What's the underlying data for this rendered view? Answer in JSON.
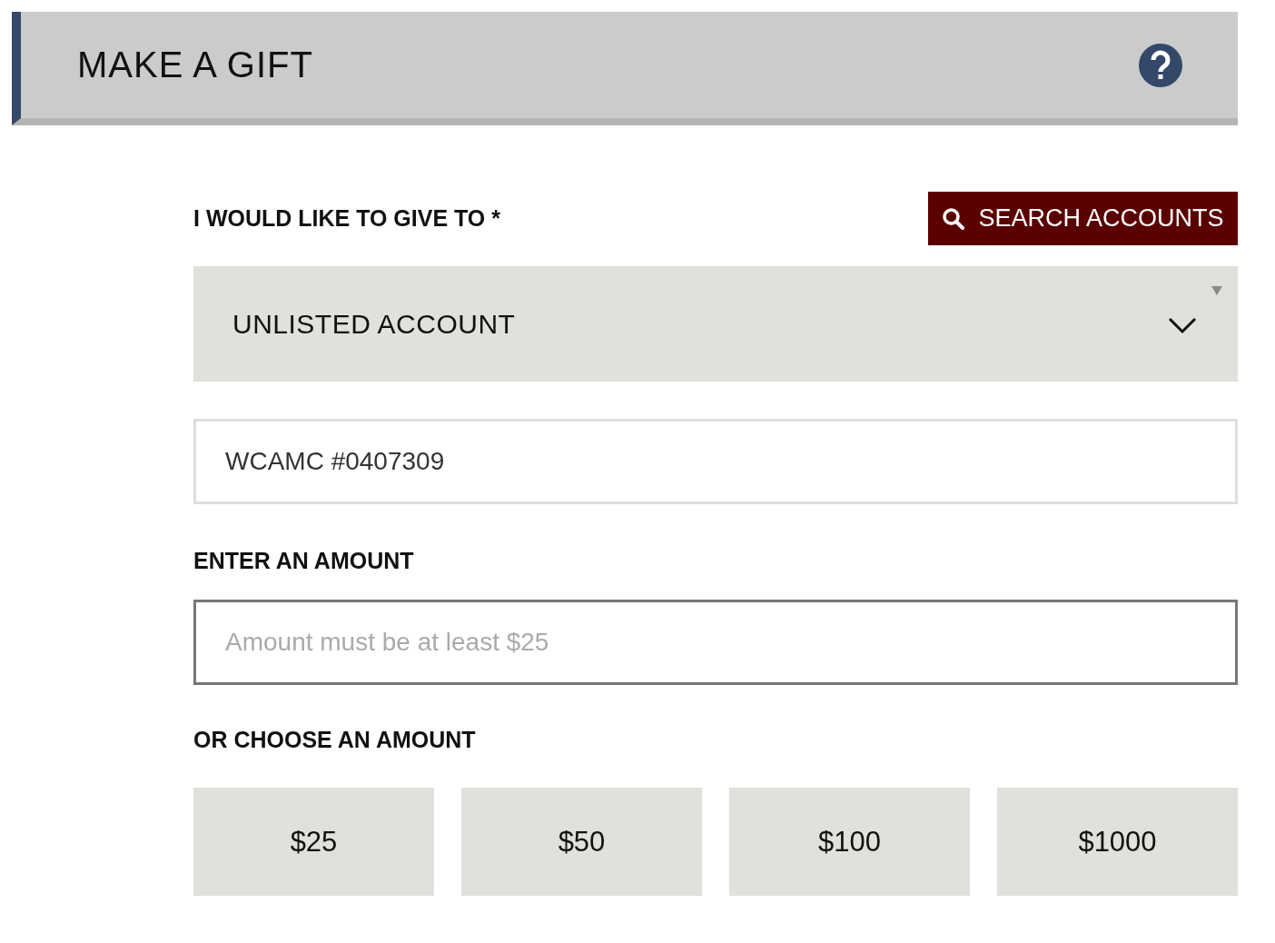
{
  "header": {
    "title": "MAKE A GIFT"
  },
  "recipient": {
    "label": "I WOULD LIKE TO GIVE TO *",
    "search_button": "SEARCH ACCOUNTS",
    "select": {
      "value": "UNLISTED ACCOUNT"
    },
    "account_field": {
      "value": "WCAMC #0407309"
    }
  },
  "amount": {
    "label": "ENTER AN AMOUNT",
    "field": {
      "placeholder": "Amount must be at least $25"
    }
  },
  "choices": {
    "label": "OR CHOOSE AN AMOUNT",
    "options": [
      {
        "label": "$25",
        "selected": false
      },
      {
        "label": "$50",
        "selected": false
      },
      {
        "label": "$100",
        "selected": false
      },
      {
        "label": "$1000",
        "selected": false
      }
    ]
  }
}
